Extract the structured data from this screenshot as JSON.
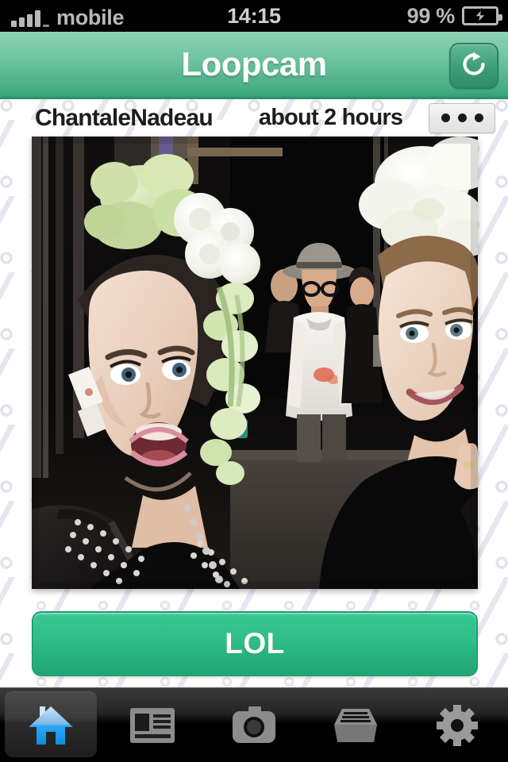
{
  "status_bar": {
    "carrier": "mobile",
    "time": "14:15",
    "battery_percent": "99 %",
    "signal_icon": "signal-bars-icon",
    "battery_icon": "battery-charging-icon"
  },
  "header": {
    "title": "Loopcam",
    "refresh_icon": "refresh-icon",
    "gradient_top": "#8ed2b6",
    "gradient_bottom": "#34a077"
  },
  "post": {
    "username": "ChantaleNadeau",
    "timestamp": "about 2 hours",
    "more_icon": "ellipsis-icon",
    "photo_alt": "Backstage fashion show selfie with floral headpieces"
  },
  "actions": {
    "lol_label": "LOL",
    "lol_color": "#2fbd89"
  },
  "tabbar": {
    "active_index": 0,
    "accent_color": "#34a3f0",
    "items": [
      {
        "name": "home",
        "icon": "home-icon",
        "active": true
      },
      {
        "name": "feed",
        "icon": "news-icon",
        "active": false
      },
      {
        "name": "camera",
        "icon": "camera-icon",
        "active": false
      },
      {
        "name": "inbox",
        "icon": "inbox-tray-icon",
        "active": false
      },
      {
        "name": "settings",
        "icon": "gear-icon",
        "active": false
      }
    ]
  }
}
